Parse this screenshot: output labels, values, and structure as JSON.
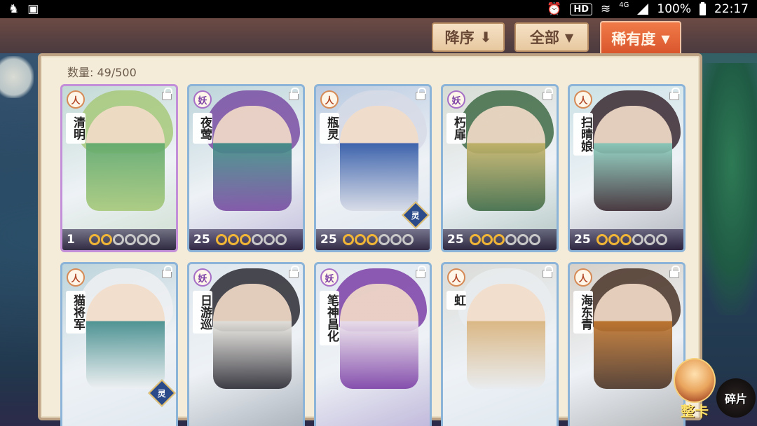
{
  "statusbar": {
    "hd": "HD",
    "network": "4G",
    "battery_percent": "100%",
    "time": "22:17"
  },
  "sort": {
    "order_label": "降序",
    "filter_label": "全部",
    "rarity_label": "稀有度"
  },
  "count": {
    "label": "数量:",
    "value": "49/500"
  },
  "cards": [
    {
      "name": "清明",
      "type": "人",
      "level": "1",
      "stars": 2,
      "max_stars": 6,
      "rarity": "violet",
      "ling": false,
      "colors": [
        "#a7c97a",
        "#5fa86c"
      ]
    },
    {
      "name": "夜莺",
      "type": "妖",
      "level": "25",
      "stars": 3,
      "max_stars": 6,
      "rarity": "blue",
      "ling": false,
      "colors": [
        "#7a4da3",
        "#3f8f85"
      ]
    },
    {
      "name": "瓶灵",
      "type": "人",
      "level": "25",
      "stars": 3,
      "max_stars": 6,
      "rarity": "blue",
      "ling": true,
      "ling_label": "灵",
      "colors": [
        "#d7dbe6",
        "#2e57a6"
      ]
    },
    {
      "name": "朽扉",
      "type": "妖",
      "level": "25",
      "stars": 3,
      "max_stars": 6,
      "rarity": "blue",
      "ling": false,
      "colors": [
        "#3f6b46",
        "#c8b56a"
      ]
    },
    {
      "name": "扫晴娘",
      "type": "人",
      "level": "25",
      "stars": 3,
      "max_stars": 6,
      "rarity": "blue",
      "ling": false,
      "colors": [
        "#3a2830",
        "#8fd3c2"
      ]
    },
    {
      "name": "猫将军",
      "type": "人",
      "level": "",
      "stars": 0,
      "max_stars": 0,
      "rarity": "blue",
      "ling": true,
      "ling_label": "灵",
      "colors": [
        "#eef0f2",
        "#3f8a8a"
      ]
    },
    {
      "name": "日游巡",
      "type": "妖",
      "level": "",
      "stars": 0,
      "max_stars": 0,
      "rarity": "blue",
      "ling": false,
      "colors": [
        "#2b2a33",
        "#f0ede6"
      ]
    },
    {
      "name": "笔神昌化",
      "type": "妖",
      "level": "",
      "stars": 0,
      "max_stars": 0,
      "rarity": "blue",
      "ling": false,
      "colors": [
        "#7b3fa6",
        "#f1e9ee"
      ]
    },
    {
      "name": "虹",
      "type": "人",
      "level": "",
      "stars": 0,
      "max_stars": 0,
      "rarity": "blue",
      "ling": false,
      "colors": [
        "#e9ecef",
        "#d9b27a"
      ]
    },
    {
      "name": "海东青",
      "type": "人",
      "level": "",
      "stars": 0,
      "max_stars": 0,
      "rarity": "blue",
      "ling": false,
      "colors": [
        "#4a3428",
        "#c4782e"
      ]
    }
  ],
  "bottom_buttons": {
    "zhengka_label": "整卡",
    "suipian_label": "碎片"
  }
}
